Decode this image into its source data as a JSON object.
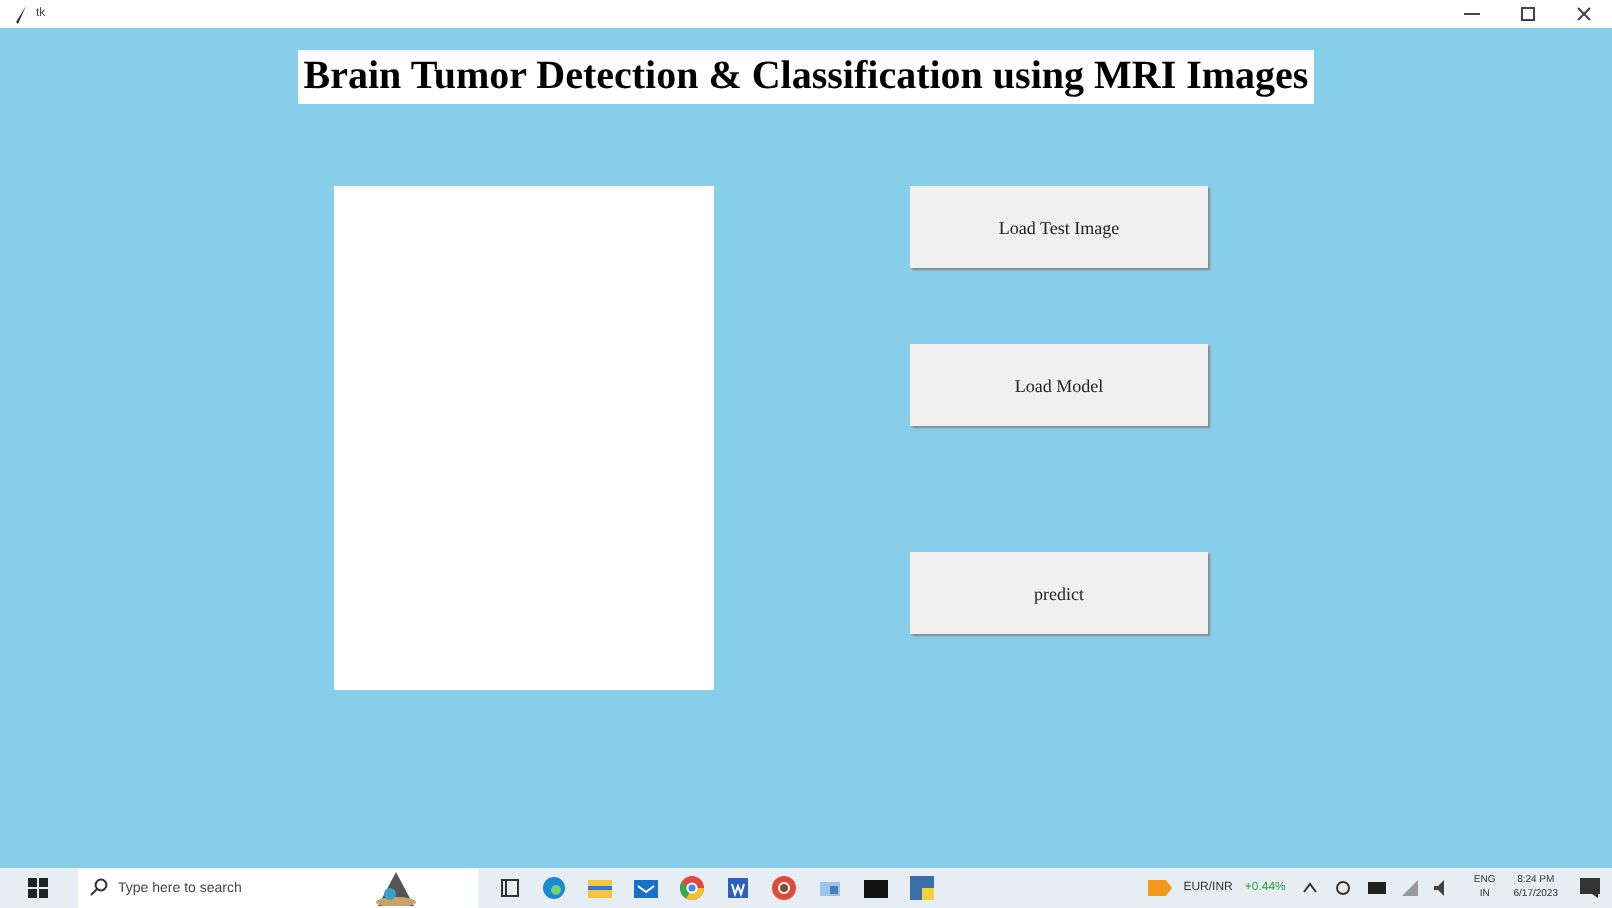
{
  "window": {
    "title": "tk"
  },
  "heading": "Brain Tumor Detection & Classification using MRI Images",
  "buttons": [
    "Load Test Image",
    "Load Model",
    "predict"
  ],
  "taskbar": {
    "search": {
      "placeholder": "Type here to search"
    },
    "ticker": {
      "pair": "EUR/INR",
      "change": "+0.44%"
    },
    "language": {
      "code": "ENG",
      "region": "IN"
    },
    "clock": {
      "time": "8:24 PM",
      "date": "6/17/2023"
    }
  }
}
